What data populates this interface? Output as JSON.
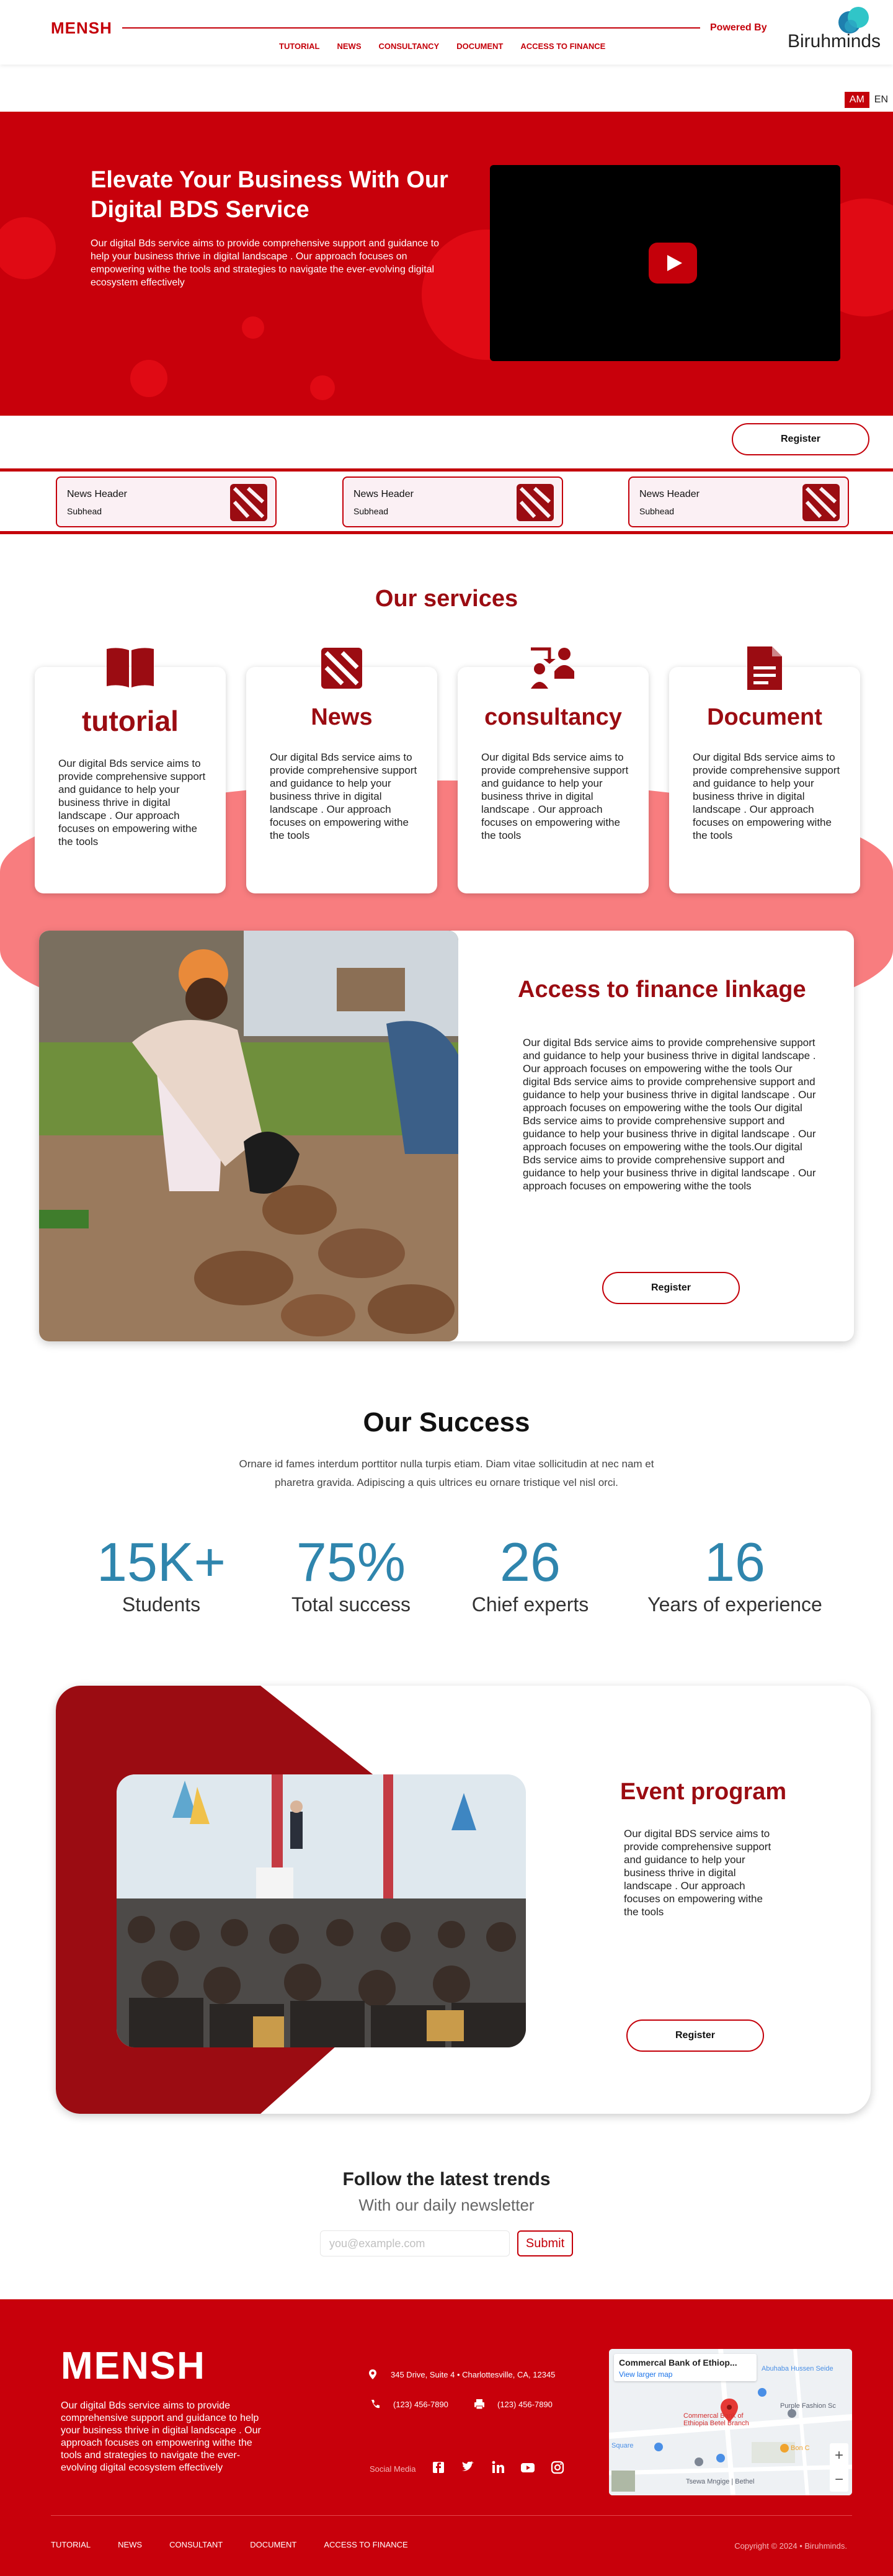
{
  "header": {
    "logo": "MENSH",
    "powered_by": "Powered By",
    "partner": "Biruhminds",
    "nav": [
      "TUTORIAL",
      "NEWS",
      "CONSULTANCY",
      "DOCUMENT",
      "ACCESS TO FINANCE"
    ]
  },
  "lang": {
    "am": "AM",
    "en": "EN",
    "active": "AM"
  },
  "hero": {
    "title": "Elevate Your Business With Our Digital BDS Service",
    "description": "Our digital Bds service aims to provide comprehensive support and guidance to help your business thrive in digital landscape . Our approach focuses on empowering withe the tools and strategies to navigate the ever-evolving digital ecosystem effectively",
    "video_icon": "play-icon"
  },
  "register_label": "Register",
  "news_cards": [
    {
      "header": "News Header",
      "subhead": "Subhead"
    },
    {
      "header": "News Header",
      "subhead": "Subhead"
    },
    {
      "header": "News Header",
      "subhead": "Subhead"
    }
  ],
  "services": {
    "title": "Our services",
    "items": [
      {
        "title": "tutorial",
        "icon": "book-icon",
        "desc": "Our digital Bds service aims to provide comprehensive support and guidance to help your business thrive in digital landscape . Our approach focuses on empowering withe the tools"
      },
      {
        "title": "News",
        "icon": "news-icon",
        "desc": "Our digital Bds service aims to provide comprehensive support and guidance to help your business thrive in digital landscape . Our approach focuses on empowering withe the tools"
      },
      {
        "title": "consultancy",
        "icon": "consultancy-icon",
        "desc": "Our digital Bds service aims to provide comprehensive support and guidance to help your business thrive in digital landscape . Our approach focuses on empowering withe the tools"
      },
      {
        "title": "Document",
        "icon": "document-icon",
        "desc": "Our digital Bds service aims to provide comprehensive support and guidance to help your business thrive in digital landscape . Our approach focuses on empowering withe the tools"
      }
    ]
  },
  "finance": {
    "title": "Access to finance linkage",
    "desc": "Our digital Bds service aims to provide comprehensive support and guidance to help your business thrive in digital landscape . Our approach focuses on empowering withe the tools Our digital Bds service aims to provide comprehensive support and guidance to help your business thrive in digital landscape . Our approach focuses on empowering withe the tools Our digital Bds service aims to provide comprehensive support and guidance to help your business thrive in digital landscape . Our approach focuses on empowering withe the tools.Our digital Bds service aims to provide comprehensive support and guidance to help your business thrive in digital landscape . Our approach focuses on empowering withe the tools"
  },
  "success": {
    "title": "Our Success",
    "desc": "Ornare id fames interdum porttitor nulla turpis etiam. Diam vitae sollicitudin at nec nam et pharetra gravida. Adipiscing a quis ultrices eu ornare tristique vel nisl orci.",
    "stats": [
      {
        "value": "15K+",
        "label": "Students"
      },
      {
        "value": "75%",
        "label": "Total success"
      },
      {
        "value": "26",
        "label": "Chief experts"
      },
      {
        "value": "16",
        "label": "Years of experience"
      }
    ]
  },
  "event": {
    "title": "Event program",
    "desc": "Our digital BDS service aims to provide comprehensive support and guidance to help your business thrive in digital landscape . Our approach focuses on empowering withe the tools"
  },
  "newsletter": {
    "title": "Follow the latest trends",
    "subtitle": "With our daily newsletter",
    "placeholder": "you@example.com",
    "submit": "Submit"
  },
  "footer": {
    "logo": "MENSH",
    "desc": "Our digital Bds service aims to provide comprehensive support and guidance to help your business thrive in digital landscape . Our approach focuses on empowering withe the tools and strategies to navigate the ever-evolving digital ecosystem effectively",
    "address": "345 Drive, Suite 4 • Charlottesville, CA, 12345",
    "phone": "(123) 456-7890",
    "fax": "(123) 456-7890",
    "social_label": "Social Media",
    "social": [
      "facebook-icon",
      "twitter-icon",
      "linkedin-icon",
      "youtube-icon",
      "instagram-icon"
    ],
    "map": {
      "name": "Commercal Bank of Ethiop...",
      "link": "View larger map",
      "labels": [
        "Commercal Bank of Ethiopia Betel Branch",
        "Abuhaba Hussen Seide",
        "Purple Fashion Sc",
        "Square",
        "Bon C",
        "Tsewa Mngige | Bethel"
      ]
    },
    "nav": [
      "TUTORIAL",
      "NEWS",
      "CONSULTANT",
      "DOCUMENT",
      "ACCESS TO FINANCE"
    ],
    "copyright": "Copyright © 2024 • Biruhminds."
  },
  "colors": {
    "brand": "#c4000a",
    "dark_red": "#9b0c12",
    "accent_blue": "#2f85ad",
    "pink": "#f87d7f"
  }
}
